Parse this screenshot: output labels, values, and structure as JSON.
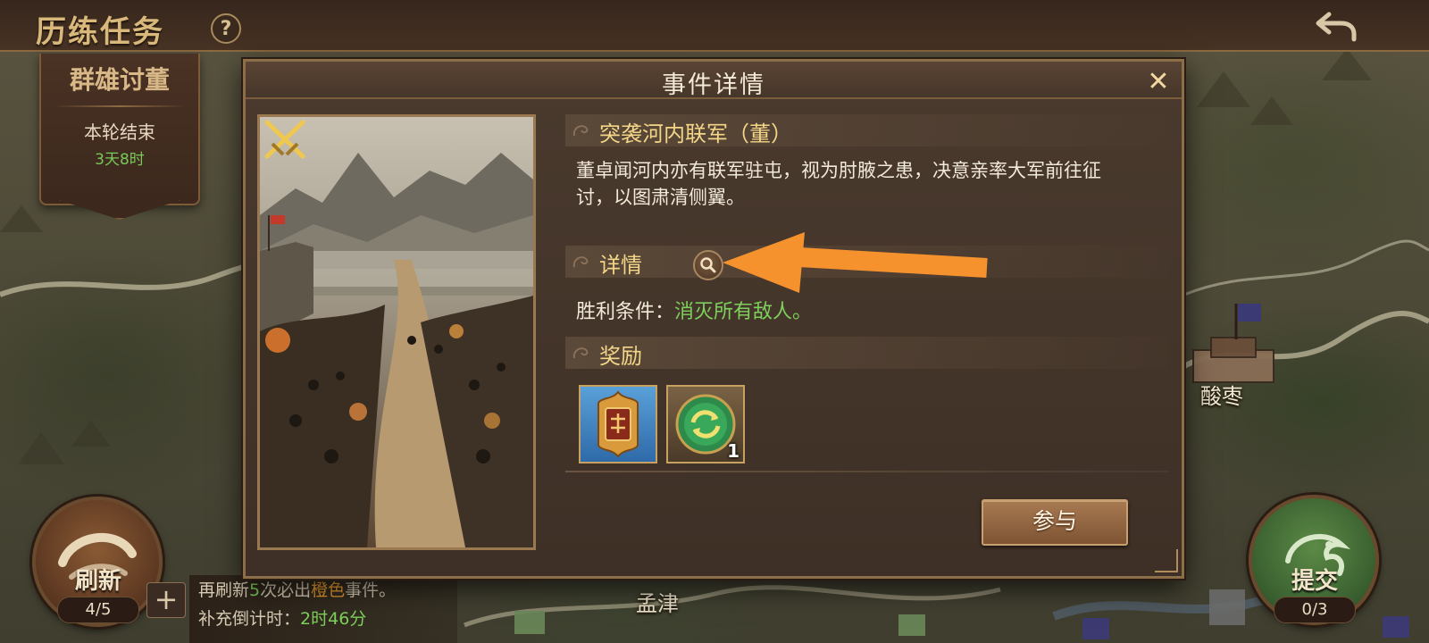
{
  "header": {
    "title": "历练任务",
    "help_label": "?"
  },
  "banner": {
    "title": "群雄讨董",
    "status": "本轮结束",
    "time_left": "3天8时"
  },
  "refresh": {
    "label": "刷新",
    "count": "4/5",
    "plus_label": "+",
    "hint_prefix": "再刷新",
    "hint_number": "5",
    "hint_middle": "次必出",
    "hint_orange": "橙色",
    "hint_suffix": "事件。",
    "countdown_label": "补充倒计时：",
    "countdown_value": "2时46分"
  },
  "submit": {
    "label": "提交",
    "count": "0/3"
  },
  "map_labels": {
    "suanzao": "酸枣",
    "mengjin": "孟津"
  },
  "modal": {
    "title": "事件详情",
    "close_label": "✕",
    "event_title": "突袭河内联军（董）",
    "description": "董卓闻河内亦有联军驻屯，视为肘腋之患，决意亲率大军前往征讨，以图肃清侧翼。",
    "details_title": "详情",
    "victory_label": "胜利条件：",
    "victory_value": "消灭所有敌人。",
    "rewards_title": "奖励",
    "rewards": [
      {
        "icon": "dong-token-icon",
        "count": ""
      },
      {
        "icon": "refresh-coin-icon",
        "count": "1"
      }
    ],
    "join_label": "参与"
  },
  "colors": {
    "accent_gold": "#f4d688",
    "success_green": "#7ed05c",
    "orange_highlight": "#f0a030",
    "annotation_arrow": "#f5922e"
  }
}
